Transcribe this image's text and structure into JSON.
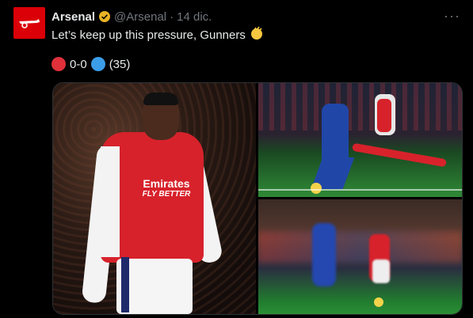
{
  "tweet": {
    "author_name": "Arsenal",
    "handle": "@Arsenal",
    "separator": "·",
    "time": "14 dic.",
    "more": "···",
    "text": "Let’s keep up this pressure, Gunners",
    "score": {
      "home_color": "#e0303a",
      "score_text": "0-0",
      "away_color": "#3b9de8",
      "minute": "(35)"
    },
    "media": {
      "photo_1": {
        "sponsor_line1": "Emirates",
        "sponsor_line2": "FLY BETTER"
      }
    }
  },
  "colors": {
    "brand_red": "#db0007",
    "verified_gold": "#e8b424",
    "muted": "#71767b"
  }
}
